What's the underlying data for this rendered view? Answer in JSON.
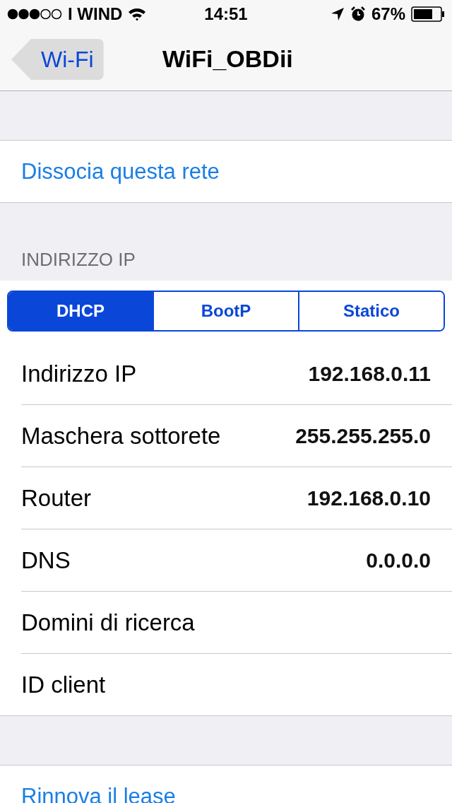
{
  "status_bar": {
    "carrier": "I WIND",
    "time": "14:51",
    "battery": "67%"
  },
  "nav": {
    "back": "Wi-Fi",
    "title": "WiFi_OBDii"
  },
  "forget": "Dissocia questa rete",
  "section_header": "INDIRIZZO IP",
  "segments": [
    {
      "label": "DHCP",
      "selected": true
    },
    {
      "label": "BootP",
      "selected": false
    },
    {
      "label": "Statico",
      "selected": false
    }
  ],
  "rows": [
    {
      "label": "Indirizzo IP",
      "value": "192.168.0.11"
    },
    {
      "label": "Maschera sottorete",
      "value": "255.255.255.0"
    },
    {
      "label": "Router",
      "value": "192.168.0.10"
    },
    {
      "label": "DNS",
      "value": "0.0.0.0"
    },
    {
      "label": "Domini di ricerca"
    },
    {
      "label": "ID client"
    }
  ],
  "renew": "Rinnova il lease"
}
